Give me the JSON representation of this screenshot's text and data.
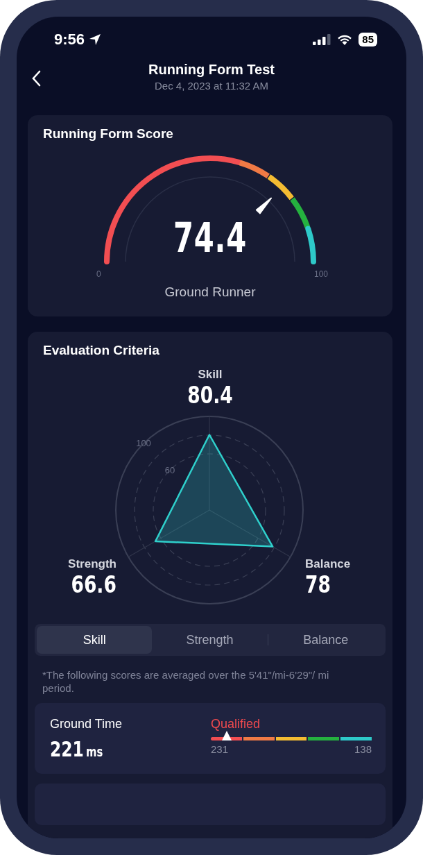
{
  "status_bar": {
    "time": "9:56",
    "battery": "85"
  },
  "header": {
    "title": "Running Form Test",
    "subtitle": "Dec 4, 2023 at 11:32 AM"
  },
  "score_card": {
    "title": "Running Form Score",
    "score": "74.4",
    "level": 0.744,
    "min_label": "0",
    "max_label": "100",
    "rating": "Ground Runner"
  },
  "criteria_card": {
    "title": "Evaluation Criteria",
    "radar": {
      "ticks": [
        "100",
        "60"
      ],
      "axes": [
        {
          "label": "Skill",
          "value": "80.4"
        },
        {
          "label": "Strength",
          "value": "66.6"
        },
        {
          "label": "Balance",
          "value": "78"
        }
      ]
    },
    "tabs": [
      {
        "label": "Skill",
        "selected": true
      },
      {
        "label": "Strength",
        "selected": false
      },
      {
        "label": "Balance",
        "selected": false
      }
    ],
    "note": "*The following scores are averaged over the 5'41\"/mi-6'29\"/ mi period.",
    "metrics": [
      {
        "name": "Ground Time",
        "value": "221",
        "unit": "ms",
        "status": "Qualified",
        "level": 0.1,
        "range_start": "231",
        "range_end": "138"
      }
    ]
  }
}
